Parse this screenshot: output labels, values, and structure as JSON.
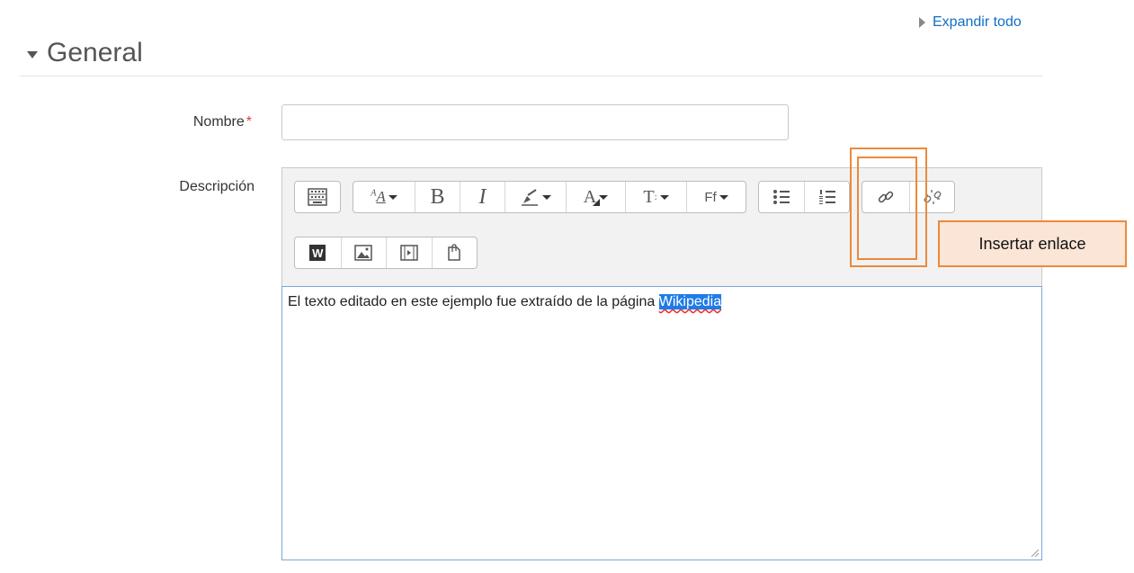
{
  "header": {
    "expand_all": "Expandir todo",
    "section_title": "General"
  },
  "form": {
    "name_label": "Nombre",
    "required_marker": "*",
    "name_value": "",
    "description_label": "Descripción"
  },
  "toolbar": {
    "buttons": [
      {
        "name": "show-more-buttons",
        "icon": "toolbar-toggle-icon"
      },
      {
        "name": "paragraph-styles",
        "icon": "paragraph-style-icon"
      },
      {
        "name": "bold",
        "label": "B"
      },
      {
        "name": "italic",
        "label": "I"
      },
      {
        "name": "highlight",
        "icon": "highlighter-icon"
      },
      {
        "name": "font-color",
        "icon": "font-color-icon"
      },
      {
        "name": "font-size",
        "label": "T"
      },
      {
        "name": "font-family",
        "label": "Ff"
      },
      {
        "name": "unordered-list",
        "icon": "bullet-list-icon"
      },
      {
        "name": "ordered-list",
        "icon": "numbered-list-icon"
      },
      {
        "name": "insert-link",
        "icon": "link-icon"
      },
      {
        "name": "remove-link",
        "icon": "unlink-icon"
      },
      {
        "name": "paste-from-word",
        "label": "W"
      },
      {
        "name": "insert-image",
        "icon": "image-icon"
      },
      {
        "name": "insert-media",
        "icon": "media-icon"
      },
      {
        "name": "manage-files",
        "icon": "files-icon"
      }
    ]
  },
  "editor": {
    "text_before": "El texto editado en este ejemplo fue extraído de la página ",
    "selected_text": "Wikipedia"
  },
  "annotation": {
    "tooltip": "Insertar enlace"
  },
  "colors": {
    "accent_link": "#0f6fc5",
    "required": "#e3413b",
    "annotation_border": "#ec8a3a",
    "annotation_fill": "#fbe5d6",
    "selection": "#1e7be8"
  }
}
